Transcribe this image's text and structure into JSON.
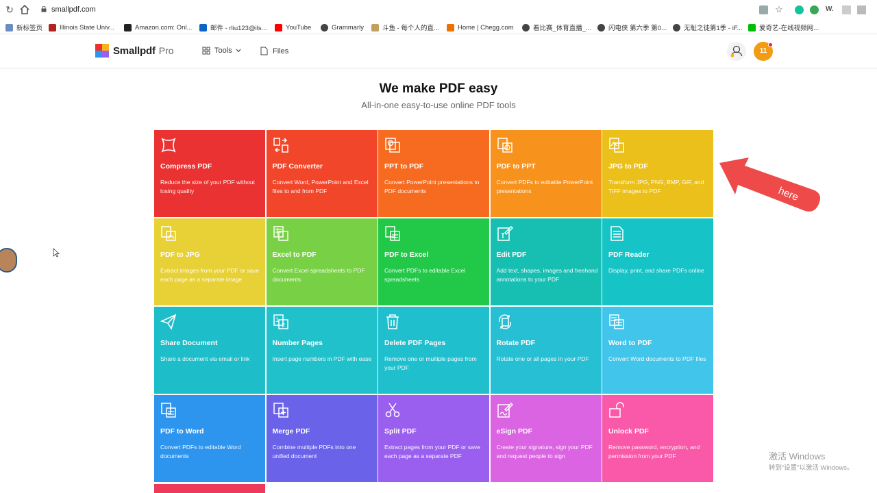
{
  "browser": {
    "url": "smallpdf.com",
    "bookmarks": [
      {
        "label": "新标签页",
        "color": "#6b8dc4"
      },
      {
        "label": "Illinois State Univ...",
        "color": "#b22222"
      },
      {
        "label": "Amazon.com: Onl...",
        "color": "#222222"
      },
      {
        "label": "邮件 - rliu123@ils...",
        "color": "#0a64c8"
      },
      {
        "label": "YouTube",
        "color": "#ff0000"
      },
      {
        "label": "Grammarly",
        "color": "#444444"
      },
      {
        "label": "斗鱼 - 每个人的直...",
        "color": "#c0a060"
      },
      {
        "label": "Home | Chegg.com",
        "color": "#eb7100"
      },
      {
        "label": "看比赛_体育直播_...",
        "color": "#444444"
      },
      {
        "label": "闪电侠 第六季 第0...",
        "color": "#444444"
      },
      {
        "label": "无耻之徒第1季 - iF...",
        "color": "#444444"
      },
      {
        "label": "爱奇艺-在线视频网...",
        "color": "#00be06"
      }
    ]
  },
  "header": {
    "logo_text": "Smallpdf",
    "logo_pro": "Pro",
    "tools_label": "Tools",
    "files_label": "Files",
    "avatar_initials": "11"
  },
  "hero": {
    "title": "We make PDF easy",
    "subtitle": "All-in-one easy-to-use online PDF tools"
  },
  "tools": [
    {
      "title": "Compress PDF",
      "desc": "Reduce the size of your PDF without losing quality",
      "color": "#ea3232",
      "icon": "compress-icon"
    },
    {
      "title": "PDF Converter",
      "desc": "Convert Word, PowerPoint and Excel files to and from PDF",
      "color": "#f2462a",
      "icon": "converter-icon"
    },
    {
      "title": "PPT to PDF",
      "desc": "Convert PowerPoint presentations to PDF documents",
      "color": "#f66b1f",
      "icon": "ppt-icon"
    },
    {
      "title": "PDF to PPT",
      "desc": "Convert PDFs to editable PowerPoint presentations",
      "color": "#f7921c",
      "icon": "pdf-ppt-icon"
    },
    {
      "title": "JPG to PDF",
      "desc": "Transform JPG, PNG, BMP, GIF, and TIFF images to PDF",
      "color": "#ecc01a",
      "icon": "jpg-icon"
    },
    {
      "title": "PDF to JPG",
      "desc": "Extract images from your PDF or save each page as a separate image",
      "color": "#e8d136",
      "icon": "pdf-jpg-icon"
    },
    {
      "title": "Excel to PDF",
      "desc": "Convert Excel spreadsheets to PDF documents",
      "color": "#78d144",
      "icon": "excel-icon"
    },
    {
      "title": "PDF to Excel",
      "desc": "Convert PDFs to editable Excel spreadsheets",
      "color": "#22c848",
      "icon": "pdf-excel-icon"
    },
    {
      "title": "Edit PDF",
      "desc": "Add text, shapes, images and freehand annotations to your PDF",
      "color": "#16bfb2",
      "icon": "edit-icon"
    },
    {
      "title": "PDF Reader",
      "desc": "Display, print, and share PDFs online",
      "color": "#16c3c6",
      "icon": "reader-icon"
    },
    {
      "title": "Share Document",
      "desc": "Share a document via email or link",
      "color": "#1dbdc9",
      "icon": "share-icon"
    },
    {
      "title": "Number Pages",
      "desc": "Insert page numbers in PDF with ease",
      "color": "#20c1cb",
      "icon": "number-icon"
    },
    {
      "title": "Delete PDF Pages",
      "desc": "Remove one or multiple pages from your PDF",
      "color": "#1fbfce",
      "icon": "trash-icon"
    },
    {
      "title": "Rotate PDF",
      "desc": "Rotate one or all pages in your PDF",
      "color": "#27bfd3",
      "icon": "rotate-icon"
    },
    {
      "title": "Word to PDF",
      "desc": "Convert Word documents to PDF files",
      "color": "#42c5ea",
      "icon": "word-icon"
    },
    {
      "title": "PDF to Word",
      "desc": "Convert PDFs to editable Word documents",
      "color": "#2d95ee",
      "icon": "pdf-word-icon"
    },
    {
      "title": "Merge PDF",
      "desc": "Combine multiple PDFs into one unified document",
      "color": "#6a63ea",
      "icon": "merge-icon"
    },
    {
      "title": "Split PDF",
      "desc": "Extract pages from your PDF or save each page as a separate PDF",
      "color": "#9b5ff0",
      "icon": "scissors-icon"
    },
    {
      "title": "eSign PDF",
      "desc": "Create your signature, sign your PDF and request people to sign",
      "color": "#db64e2",
      "icon": "esign-icon"
    },
    {
      "title": "Unlock PDF",
      "desc": "Remove password, encryption, and permission from your PDF",
      "color": "#fa58a8",
      "icon": "unlock-icon"
    }
  ],
  "annotation": {
    "text": "here",
    "color": "#ee4a4a"
  },
  "watermark": {
    "line1": "激活 Windows",
    "line2": "转到“设置”以激活 Windows。"
  }
}
